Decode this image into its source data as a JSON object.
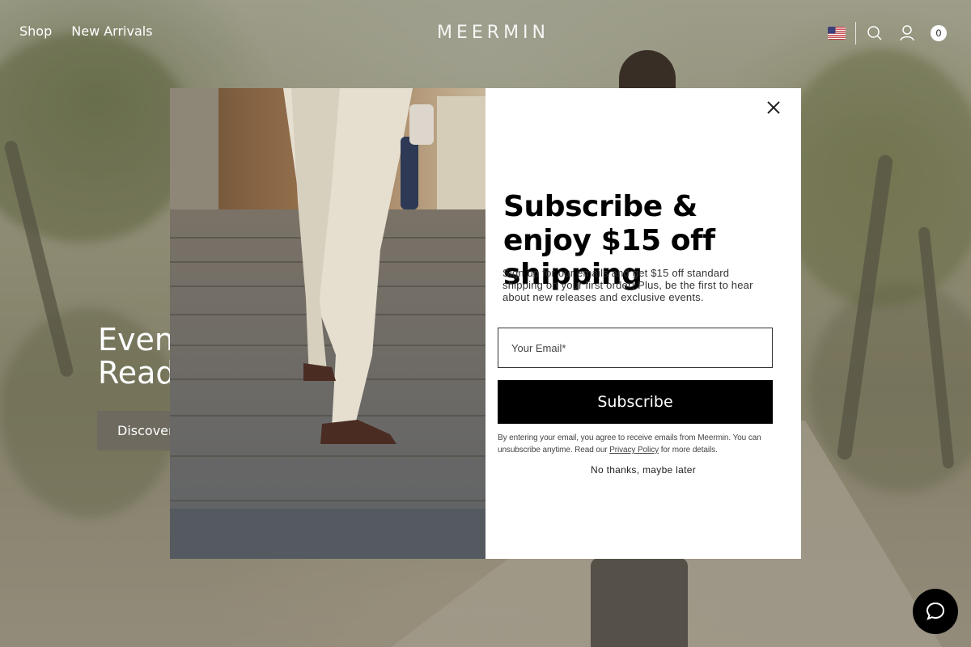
{
  "header": {
    "nav": [
      {
        "label": "Shop"
      },
      {
        "label": "New Arrivals"
      }
    ],
    "logo": "MEERMIN",
    "cart_count": "0",
    "icons": [
      "us-flag-icon",
      "search-icon",
      "account-icon",
      "cart-icon"
    ]
  },
  "hero": {
    "headline_line1": "Even",
    "headline_line2": "Read",
    "cta_label": "Discover"
  },
  "popup": {
    "title": "Subscribe & enjoy $15 off shipping",
    "description": "Sign up for our emails and get $15 off standard shipping on your first order! Plus, be the first to hear about new releases and exclusive events.",
    "email_placeholder": "Your Email*",
    "subscribe_label": "Subscribe",
    "legal_prefix": "By entering your email, you agree to receive emails from Meermin. You can unsubscribe anytime. Read our ",
    "legal_link": "Privacy Policy",
    "legal_suffix": " for more details.",
    "dismiss_label": "No thanks, maybe later"
  },
  "chat": {
    "icon": "chat-bubble-icon"
  },
  "colors": {
    "primary_button": "#000000",
    "hero_button": "#6e6a5f",
    "modal_background": "#ffffff"
  }
}
